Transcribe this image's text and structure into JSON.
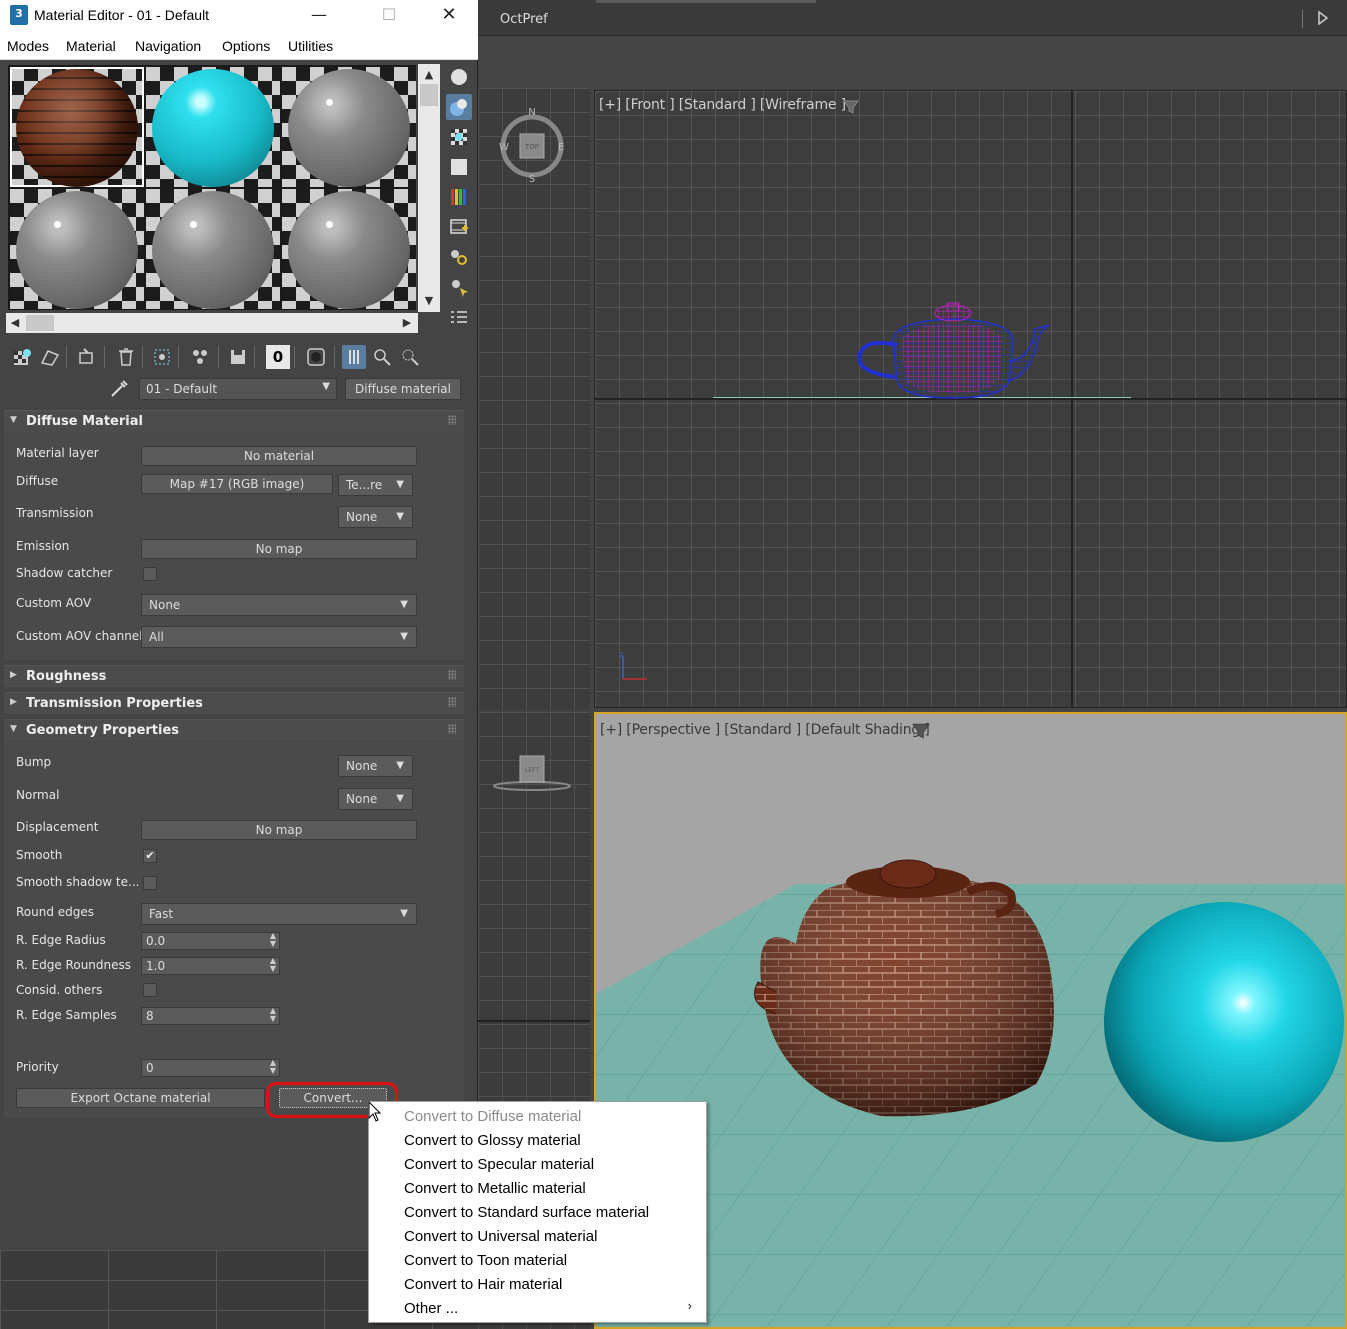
{
  "window": {
    "title": "Material Editor - 01 - Default",
    "app_icon": "3",
    "minimize": "—",
    "maximize": "☐",
    "close": "✕"
  },
  "menubar": [
    "Modes",
    "Material",
    "Navigation",
    "Options",
    "Utilities"
  ],
  "background": {
    "top_label": "OctPref",
    "viewport_front_label": "[+] [Front ] [Standard ] [Wireframe ]",
    "viewport_persp_label": "[+] [Perspective ] [Standard ] [Default Shading ]",
    "viewcube_top": "TOP",
    "viewcube_left": "LEFT",
    "compass": {
      "n": "N",
      "s": "S",
      "e": "E",
      "w": "W"
    }
  },
  "slots": [
    {
      "material": "brick",
      "selected": true
    },
    {
      "material": "cyan",
      "selected": false
    },
    {
      "material": "gray",
      "selected": false
    },
    {
      "material": "gray",
      "selected": false
    },
    {
      "material": "gray",
      "selected": false
    },
    {
      "material": "gray",
      "selected": false
    }
  ],
  "toolbar": {
    "material_id": "0"
  },
  "name_row": {
    "material_name": "01 - Default",
    "material_type": "Diffuse material"
  },
  "rollouts": {
    "diffuse": {
      "title": "Diffuse Material",
      "material_layer_label": "Material layer",
      "material_layer_value": "No material",
      "diffuse_label": "Diffuse",
      "diffuse_map": "Map #17 (RGB image)",
      "diffuse_mode": "Te...re",
      "transmission_label": "Transmission",
      "transmission_value": "None",
      "emission_label": "Emission",
      "emission_value": "No map",
      "shadow_catcher_label": "Shadow catcher",
      "custom_aov_label": "Custom AOV",
      "custom_aov_value": "None",
      "custom_aov_channel_label": "Custom AOV channel",
      "custom_aov_channel_value": "All"
    },
    "roughness": {
      "title": "Roughness"
    },
    "transmission_props": {
      "title": "Transmission Properties"
    },
    "geometry": {
      "title": "Geometry Properties",
      "bump_label": "Bump",
      "bump_value": "None",
      "normal_label": "Normal",
      "normal_value": "None",
      "displacement_label": "Displacement",
      "displacement_value": "No map",
      "smooth_label": "Smooth",
      "smooth_checked": "✔",
      "smooth_shadow_label": "Smooth shadow te...",
      "round_edges_label": "Round edges",
      "round_edges_value": "Fast",
      "edge_radius_label": "R. Edge Radius",
      "edge_radius_value": "0.0",
      "edge_roundness_label": "R. Edge Roundness",
      "edge_roundness_value": "1.0",
      "consid_others_label": "Consid. others",
      "edge_samples_label": "R. Edge Samples",
      "edge_samples_value": "8",
      "priority_label": "Priority",
      "priority_value": "0",
      "export_label": "Export Octane material",
      "convert_label": "Convert..."
    }
  },
  "context_menu": {
    "items": [
      {
        "label": "Convert to Diffuse material",
        "disabled": true
      },
      {
        "label": "Convert to Glossy material",
        "disabled": false
      },
      {
        "label": "Convert to Specular material",
        "disabled": false
      },
      {
        "label": "Convert to Metallic material",
        "disabled": false
      },
      {
        "label": "Convert to Standard surface material",
        "disabled": false
      },
      {
        "label": "Convert to Universal material",
        "disabled": false
      },
      {
        "label": "Convert to Toon material",
        "disabled": false
      },
      {
        "label": "Convert to Hair material",
        "disabled": false
      },
      {
        "label": "Other ...",
        "disabled": false
      }
    ],
    "submenu_arrow": "›"
  },
  "colors": {
    "highlight": "#e01010",
    "active_tool": "#5a7ea0",
    "viewport_active_border": "#d5a520",
    "teapot_wire": "#2030d0",
    "teapot_wire_alt": "#c020c0",
    "floor": "#77b3a8"
  }
}
